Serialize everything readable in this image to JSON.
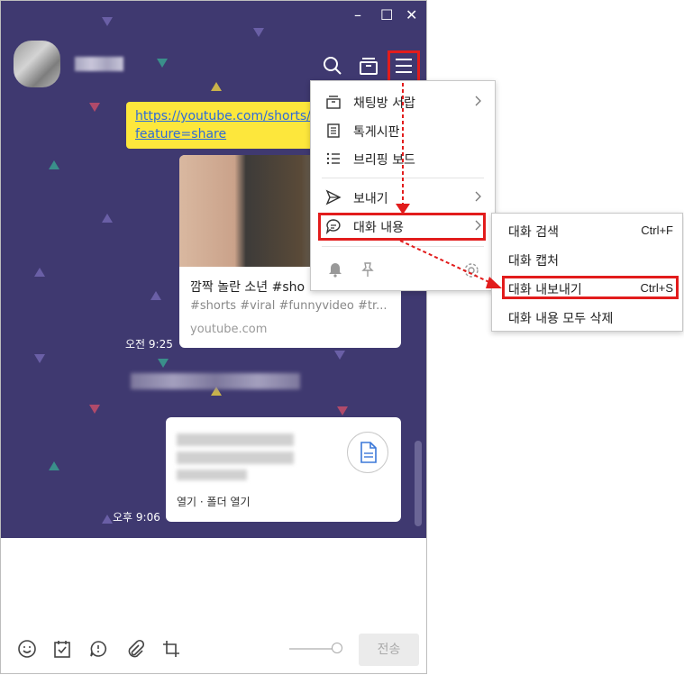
{
  "window": {
    "controls": [
      "–",
      "☐",
      "✕"
    ],
    "header_icons": [
      "search-icon",
      "drawer-icon",
      "menu-icon"
    ]
  },
  "chat": {
    "background": "#3f3970",
    "shared_link": {
      "line1": "https://youtube.com/shorts/8",
      "line2": "feature=share"
    },
    "link_card": {
      "title": "깜짝 놀란 소년 #sho",
      "tags": "#shorts #viral #funnyvideo #tr...",
      "domain": "youtube.com"
    },
    "time1": "오전 9:25",
    "file_card": {
      "actions": "열기 · 폴더 열기"
    },
    "time2": "오후 9:06"
  },
  "menu": {
    "items": [
      {
        "label": "채팅방 서랍",
        "icon": "drawer-icon"
      },
      {
        "label": "톡게시판",
        "icon": "board-icon"
      },
      {
        "label": "브리핑 보드",
        "icon": "list-icon"
      },
      {
        "label": "보내기",
        "icon": "send-icon"
      },
      {
        "label": "대화 내용",
        "icon": "chat-bubble-icon"
      }
    ],
    "bottom_icons": [
      "bell-icon",
      "pin-icon",
      "gear-icon"
    ]
  },
  "submenu": {
    "items": [
      {
        "label": "대화 검색",
        "shortcut": "Ctrl+F"
      },
      {
        "label": "대화 캡처",
        "shortcut": ""
      },
      {
        "label": "대화 내보내기",
        "shortcut": "Ctrl+S"
      },
      {
        "label": "대화 내용 모두 삭제",
        "shortcut": ""
      }
    ]
  },
  "input": {
    "toolbar_icons": [
      "emoji-icon",
      "calendar-check-icon",
      "speech-icon",
      "paperclip-icon",
      "crop-icon"
    ],
    "send_label": "전송"
  },
  "colors": {
    "highlight": "#e21c1c",
    "link": "#2f6bd8",
    "bubble": "#fde73c"
  }
}
